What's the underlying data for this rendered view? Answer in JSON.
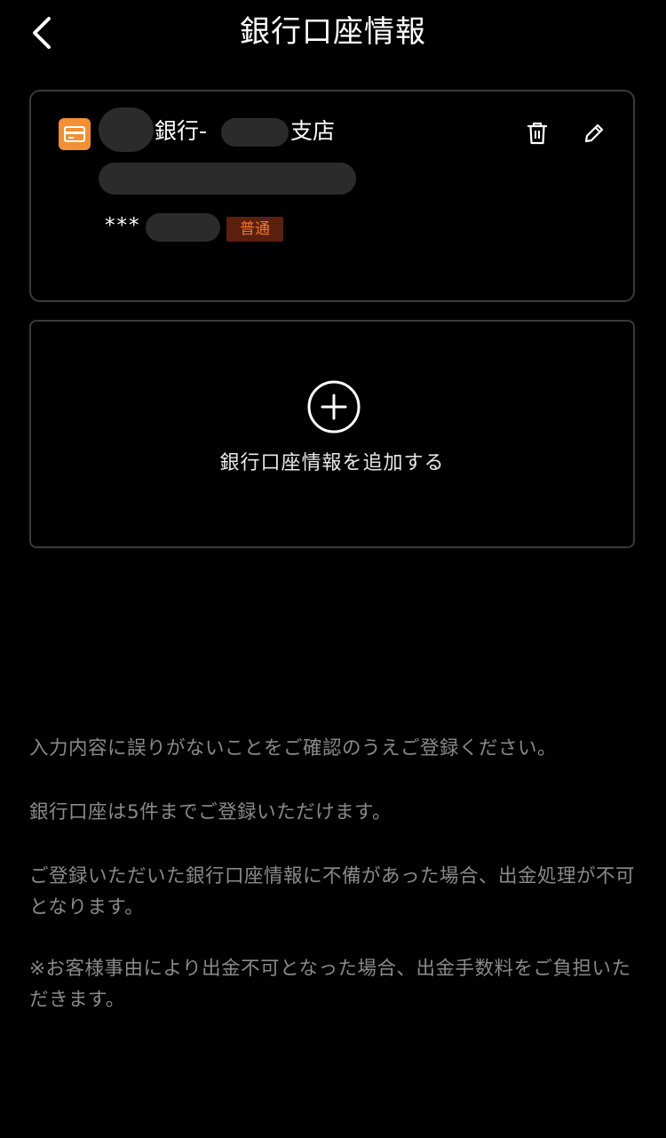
{
  "header": {
    "title": "銀行口座情報",
    "back_icon": "chevron-left-icon"
  },
  "account": {
    "bank_name": "銀行-",
    "branch_suffix": "支店",
    "account_number_prefix": "***",
    "account_type": "普通",
    "icon": "bank-card-icon",
    "delete_icon": "trash-icon",
    "edit_icon": "pencil-icon",
    "accent_color": "#f39035"
  },
  "add_account": {
    "icon": "plus-circle-icon",
    "label": "銀行口座情報を追加する"
  },
  "notes": [
    "入力内容に誤りがないことをご確認のうえご登録ください。",
    "銀行口座は5件までご登録いただけます。",
    "ご登録いただいた銀行口座情報に不備があった場合、出金処理が不可となります。",
    "※お客様事由により出金不可となった場合、出金手数料をご負担いただきます。"
  ]
}
